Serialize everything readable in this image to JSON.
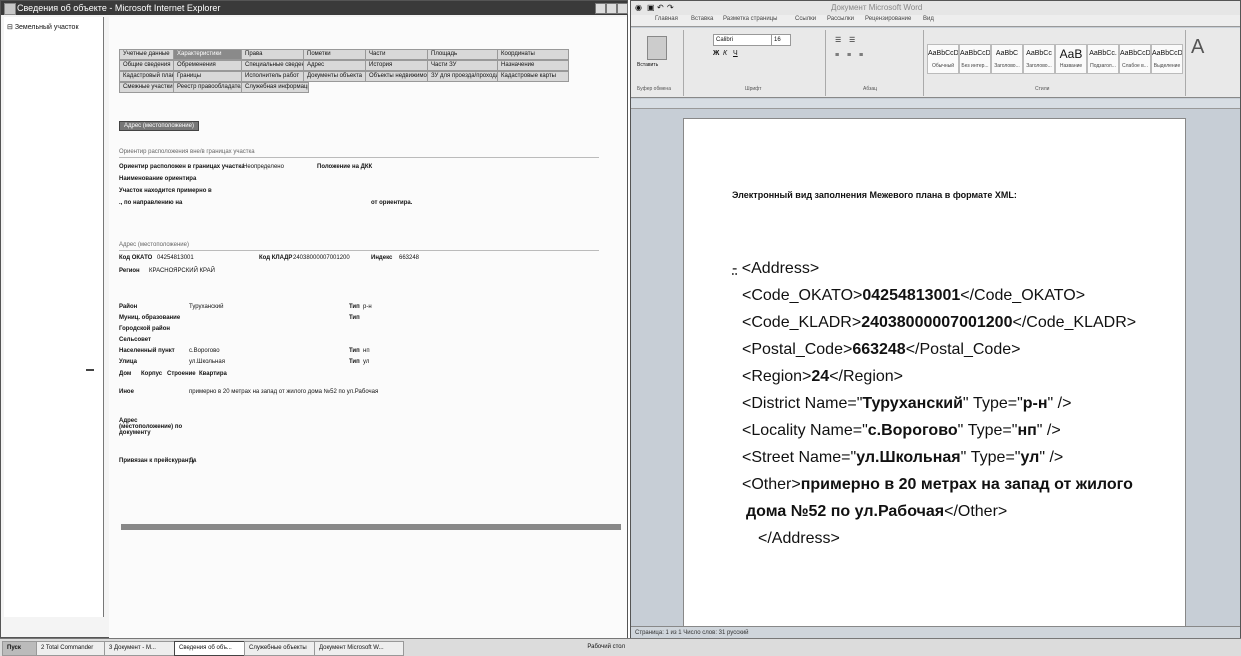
{
  "ie": {
    "title": "Сведения об объекте - Microsoft Internet Explorer",
    "tree_node": "Земельный участок",
    "tabs_row1": [
      "Учетные данные",
      "Характеристики",
      "Права",
      "Пометки",
      "Части",
      "Площадь",
      "Координаты"
    ],
    "tabs_row2": [
      "Общие сведения",
      "Обременения",
      "Специальные сведения",
      "Адрес",
      "История",
      "Части ЗУ",
      "Назначение"
    ],
    "tabs_row3": [
      "Кадастровый план",
      "Границы",
      "Исполнитель работ",
      "Документы объекта",
      "Объекты недвижимости",
      "ЗУ для проезда/прохода",
      "Кадастровые карты"
    ],
    "tabs_row4": [
      "Смежные участки",
      "Реестр правообладателей",
      "Служебная информация"
    ],
    "address_button": "Адрес (местоположение)",
    "sec_orient": "Ориентир расположения вне/в границах участка",
    "orient_label": "Ориентир расположен в границах участка",
    "orient_value": "Неопределено",
    "orient_note": "Положение на ДКК",
    "orient_name_label": "Наименование ориентира",
    "orient_plot_label": "Участок находится примерно в",
    "orient_direction_label": "., по направлению на",
    "orient_from_label": "от ориентира.",
    "sec_address": "Адрес (местоположение)",
    "okato_label": "Код ОКАТО",
    "okato_value": "04254813001",
    "kladr_label": "Код КЛАДР",
    "kladr_value": "24038000007001200",
    "index_label": "Индекс",
    "index_value": "663248",
    "region_label": "Регион",
    "region_value": "КРАСНОЯРСКИЙ КРАЙ",
    "district_label": "Район",
    "district_value": "Туруханский",
    "type_label": "Тип",
    "district_type": "р-н",
    "muni_label": "Муниц. образование",
    "cityarea_label": "Городской район",
    "selsovet_label": "Сельсовет",
    "locality_label": "Населенный пункт",
    "locality_value": "с.Ворогово",
    "locality_type": "нп",
    "street_label": "Улица",
    "street_value": "ул.Школьная",
    "street_type": "ул",
    "house_label": "Дом",
    "korpus_label": "Корпус",
    "building_label": "Строение",
    "flat_label": "Квартира",
    "other_label": "Иное",
    "other_value": "примерно в 20 метрах на запад от жилого дома №52 по ул.Рабочая",
    "doc_address_label": "Адрес (местоположение) по документу",
    "ref_label": "Привязан к прейскуранту",
    "ref_value": "Да"
  },
  "word": {
    "window_title": "Документ Microsoft Word",
    "tabs": [
      "Главная",
      "Вставка",
      "Разметка страницы",
      "Ссылки",
      "Рассылки",
      "Рецензирование",
      "Вид"
    ],
    "font_name": "Calibri",
    "font_size": "16",
    "styles": [
      {
        "sample": "AaBbCcDc",
        "name": "Обычный"
      },
      {
        "sample": "AaBbCcDc",
        "name": "Без интер..."
      },
      {
        "sample": "AaBbC",
        "name": "Заголово..."
      },
      {
        "sample": "AaBbCc",
        "name": "Заголово..."
      },
      {
        "sample": "AaB",
        "name": "Название"
      },
      {
        "sample": "AaBbCc.",
        "name": "Подзагол..."
      },
      {
        "sample": "AaBbCcDc",
        "name": "Слабое в..."
      },
      {
        "sample": "AaBbCcDc",
        "name": "Выделение"
      }
    ],
    "group_labels": [
      "Буфер обмена",
      "Шрифт",
      "Абзац",
      "Стили"
    ],
    "paste_label": "Вставить",
    "status": "Страница: 1 из 1   Число слов: 31   русский",
    "doc": {
      "heading": "Электронный вид заполнения Межевого плана в формате XML:",
      "collapse": "-",
      "l1": "<Address>",
      "l2_open": "<Code_OKATO>",
      "okato": "04254813001",
      "l2_close": "</Code_OKATO>",
      "l3_open": "<Code_KLADR>",
      "kladr": "24038000007001200",
      "l3_close": "</Code_KLADR>",
      "l4_open": "<Postal_Code>",
      "postal": "663248",
      "l4_close": "</Postal_Code>",
      "l5_open": "<Region>",
      "region": "24",
      "l5_close": "</Region>",
      "l6_a": "<District Name=\"",
      "district": "Туруханский",
      "l6_b": "\" Type=\"",
      "district_type": "р-н",
      "l6_c": "\" />",
      "l7_a": "<Locality Name=\"",
      "locality": "с.Ворогово",
      "l7_b": "\" Type=\"",
      "locality_type": "нп",
      "l7_c": "\" />",
      "l8_a": "<Street Name=\"",
      "street": "ул.Школьная",
      "l8_b": "\" Type=\"",
      "street_type": "ул",
      "l8_c": "\" />",
      "l9_open": "<Other>",
      "other_1": "примерно в 20 метрах на запад от жилого",
      "other_2": "дома №52 по ул.Рабочая",
      "l10_close": "</Other>",
      "l11": "</Address>"
    }
  },
  "taskbar": {
    "start": "Пуск",
    "tasks": [
      "2 Total Commander",
      "3 Документ - M...",
      "Сведения об объ...",
      "Служебные объекты",
      "Документ Microsoft W..."
    ],
    "tray": "Рабочий стол"
  }
}
